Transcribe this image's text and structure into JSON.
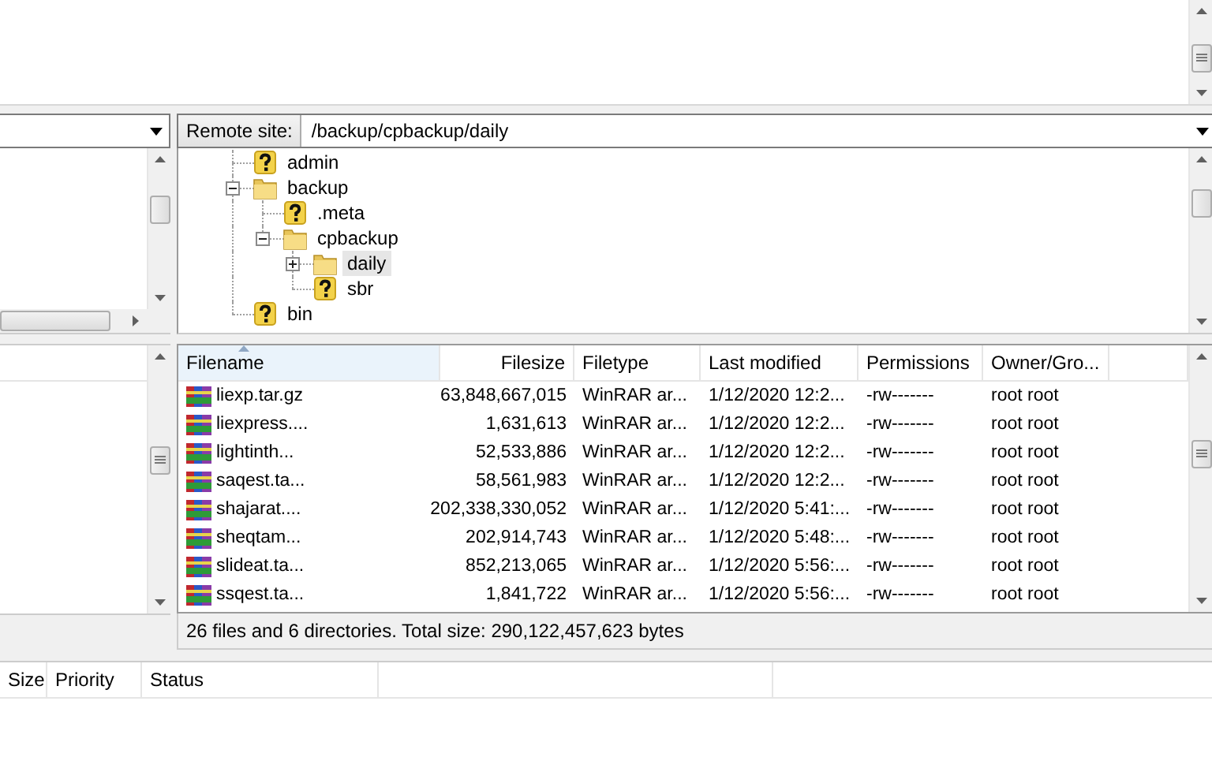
{
  "remote_site": {
    "label": "Remote site:",
    "path": "/backup/cpbackup/daily",
    "tree": [
      {
        "name": "admin",
        "kind": "unknown",
        "selected": false
      },
      {
        "name": "backup",
        "kind": "folder",
        "expanded": true,
        "selected": false,
        "children": [
          {
            "name": ".meta",
            "kind": "unknown",
            "selected": false
          },
          {
            "name": "cpbackup",
            "kind": "folder",
            "expanded": true,
            "selected": false,
            "children": [
              {
                "name": "daily",
                "kind": "folder",
                "expanded": false,
                "selected": true
              },
              {
                "name": "sbr",
                "kind": "unknown",
                "selected": false
              }
            ]
          }
        ]
      },
      {
        "name": "bin",
        "kind": "unknown",
        "selected": false
      }
    ]
  },
  "remote_files": {
    "columns": [
      {
        "label": "Filename",
        "sorted": true
      },
      {
        "label": "Filesize",
        "sorted": false
      },
      {
        "label": "Filetype",
        "sorted": false
      },
      {
        "label": "Last modified",
        "sorted": false
      },
      {
        "label": "Permissions",
        "sorted": false
      },
      {
        "label": "Owner/Gro...",
        "sorted": false
      }
    ],
    "rows": [
      {
        "filename": "liexp.tar.gz",
        "filesize": "63,848,667,015",
        "filetype": "WinRAR ar...",
        "last_modified": "1/12/2020 12:2...",
        "permissions": "-rw-------",
        "owner_group": "root root"
      },
      {
        "filename": "liexpress....",
        "filesize": "1,631,613",
        "filetype": "WinRAR ar...",
        "last_modified": "1/12/2020 12:2...",
        "permissions": "-rw-------",
        "owner_group": "root root"
      },
      {
        "filename": "lightinth...",
        "filesize": "52,533,886",
        "filetype": "WinRAR ar...",
        "last_modified": "1/12/2020 12:2...",
        "permissions": "-rw-------",
        "owner_group": "root root"
      },
      {
        "filename": "saqest.ta...",
        "filesize": "58,561,983",
        "filetype": "WinRAR ar...",
        "last_modified": "1/12/2020 12:2...",
        "permissions": "-rw-------",
        "owner_group": "root root"
      },
      {
        "filename": "shajarat....",
        "filesize": "202,338,330,052",
        "filetype": "WinRAR ar...",
        "last_modified": "1/12/2020 5:41:...",
        "permissions": "-rw-------",
        "owner_group": "root root"
      },
      {
        "filename": "sheqtam...",
        "filesize": "202,914,743",
        "filetype": "WinRAR ar...",
        "last_modified": "1/12/2020 5:48:...",
        "permissions": "-rw-------",
        "owner_group": "root root"
      },
      {
        "filename": "slideat.ta...",
        "filesize": "852,213,065",
        "filetype": "WinRAR ar...",
        "last_modified": "1/12/2020 5:56:...",
        "permissions": "-rw-------",
        "owner_group": "root root"
      },
      {
        "filename": "ssqest.ta...",
        "filesize": "1,841,722",
        "filetype": "WinRAR ar...",
        "last_modified": "1/12/2020 5:56:...",
        "permissions": "-rw-------",
        "owner_group": "root root"
      }
    ],
    "status": "26 files and 6 directories. Total size: 290,122,457,623 bytes"
  },
  "queue": {
    "columns": [
      "Size",
      "Priority",
      "Status"
    ]
  }
}
